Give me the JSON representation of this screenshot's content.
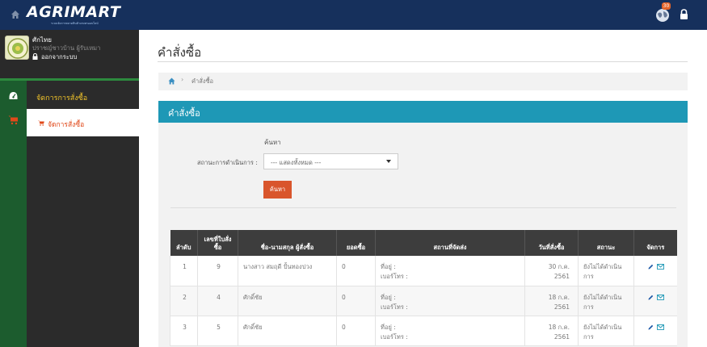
{
  "header": {
    "logo_title": "AGRIMART",
    "logo_subtitle": "ระบบจัดการตลาดสินค้าเกษตรออนไลน์",
    "notification_count": "30"
  },
  "profile": {
    "name": "ศักไทย",
    "role": "ปราชญ์ชาวบ้าน ผู้รับเหมา",
    "logout": "ออกจากระบบ"
  },
  "sidebar": {
    "items": [
      {
        "label": "จัดการการสั่งซื้อ"
      },
      {
        "label": "จัดการสั่งซื้อ"
      }
    ]
  },
  "page": {
    "title": "คำสั่งซื้อ",
    "breadcrumb_current": "คำสั่งซื้อ",
    "panel_title": "คำสั่งซื้อ"
  },
  "search": {
    "title": "ค้นหา",
    "status_label": "สถานะการดำเนินการ :",
    "status_value": "--- แสดงทั้งหมด ---",
    "button": "ค้นหา"
  },
  "table": {
    "headers": [
      "ลำดับ",
      "เลขที่ใบสั่งซื้อ",
      "ชื่อ-นามสกุล ผู้สั่งซื้อ",
      "ยอดซื้อ",
      "สถานที่จัดส่ง",
      "วันที่สั่งซื้อ",
      "สถานะ",
      "จัดการ"
    ],
    "rows": [
      {
        "no": "1",
        "order_no": "9",
        "customer": "นางสาว สมฤดี ปั้นทองปวง",
        "amount": "0",
        "addr_label": "ที่อยู่ :",
        "phone_label": "เบอร์โทร :",
        "date_line1": "30 ก.ค.",
        "date_line2": "2561",
        "status_line1": "ยังไม่ได้ดำเนิน",
        "status_line2": "การ"
      },
      {
        "no": "2",
        "order_no": "4",
        "customer": "ศักดิ์ชัย",
        "amount": "0",
        "addr_label": "ที่อยู่ :",
        "phone_label": "เบอร์โทร :",
        "date_line1": "18 ก.ค.",
        "date_line2": "2561",
        "status_line1": "ยังไม่ได้ดำเนิน",
        "status_line2": "การ"
      },
      {
        "no": "3",
        "order_no": "5",
        "customer": "ศักดิ์ชัย",
        "amount": "0",
        "addr_label": "ที่อยู่ :",
        "phone_label": "เบอร์โทร :",
        "date_line1": "18 ก.ค.",
        "date_line2": "2561",
        "status_line1": "ยังไม่ได้ดำเนิน",
        "status_line2": "การ"
      }
    ]
  },
  "colors": {
    "topbar": "#16305c",
    "sidebar": "#2b2b2b",
    "sidebar_strip": "#1c5c2e",
    "panel_header": "#1e98b6",
    "search_button": "#d9552c",
    "active_menu_text": "#e0491a",
    "menu_text": "#f3c52a"
  },
  "icons": {
    "home": "home-icon",
    "globe": "globe-icon",
    "lock": "lock-icon",
    "dashboard": "dashboard-icon",
    "cart": "cart-icon",
    "edit": "pencil-icon",
    "mail": "mail-icon"
  }
}
